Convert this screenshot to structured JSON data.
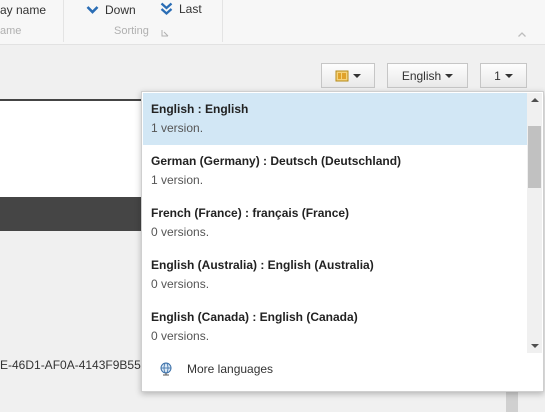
{
  "ribbon": {
    "display_name_label": "ay name",
    "name_group_label": "ame",
    "down_label": "Down",
    "last_label": "Last",
    "sorting_group_label": "Sorting"
  },
  "toolbar": {
    "language_label": "English",
    "version_label": "1"
  },
  "content": {
    "guid_text": "E-46D1-AF0A-4143F9B55"
  },
  "dropdown": {
    "languages": [
      {
        "name": "English : English",
        "versions": "1 version.",
        "selected": true
      },
      {
        "name": "German (Germany) : Deutsch (Deutschland)",
        "versions": "1 version.",
        "selected": false
      },
      {
        "name": "French (France) : français (France)",
        "versions": "0 versions.",
        "selected": false
      },
      {
        "name": "English (Australia) : English (Australia)",
        "versions": "0 versions.",
        "selected": false
      },
      {
        "name": "English (Canada) : English (Canada)",
        "versions": "0 versions.",
        "selected": false
      }
    ],
    "more_languages_label": "More languages"
  },
  "colors": {
    "accent_blue": "#2a6db5",
    "selected_bg": "#d2e7f5",
    "dark_bar": "#454545"
  }
}
